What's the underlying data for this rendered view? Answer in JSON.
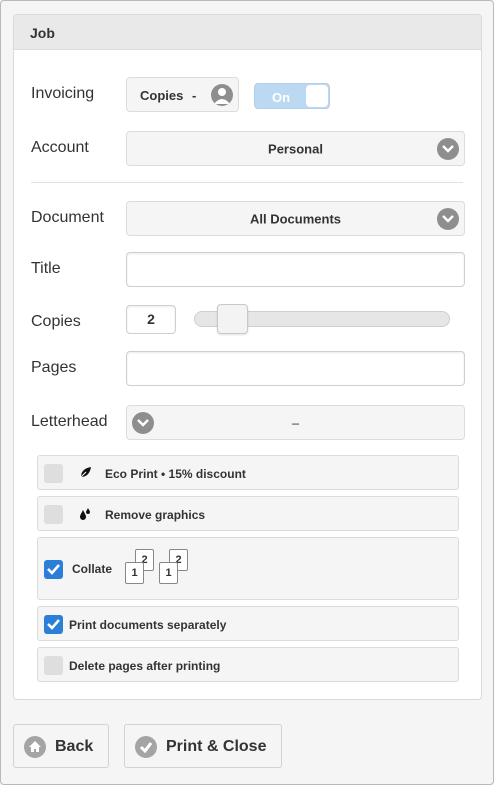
{
  "panel": {
    "title": "Job"
  },
  "invoicing": {
    "label": "Invoicing",
    "button_label": "Copies",
    "button_separator": "-",
    "toggle_label": "On"
  },
  "account": {
    "label": "Account",
    "selected": "Personal"
  },
  "document": {
    "label": "Document",
    "selected": "All Documents"
  },
  "title_field": {
    "label": "Title",
    "value": ""
  },
  "copies": {
    "label": "Copies",
    "value": "2",
    "slider_fraction": 0.1
  },
  "pages_field": {
    "label": "Pages",
    "value": ""
  },
  "letterhead": {
    "label": "Letterhead",
    "selected": "–"
  },
  "options": [
    {
      "label": "Eco Print • 15% discount",
      "checked": false,
      "icon": "leaf-icon"
    },
    {
      "label": "Remove graphics",
      "checked": false,
      "icon": "ink-drops-icon"
    },
    {
      "label": "Collate",
      "checked": true,
      "icon": "collate-pages-icon",
      "page_numbers": [
        "1",
        "2",
        "1",
        "2"
      ]
    },
    {
      "label": "Print documents separately",
      "checked": true
    },
    {
      "label": "Delete pages after printing",
      "checked": false
    }
  ],
  "footer": {
    "back_label": "Back",
    "print_label": "Print & Close"
  },
  "colors": {
    "accent": "#2b7fd6",
    "toggle": "#bcd9f3",
    "chevron": "#8e8e8e"
  }
}
